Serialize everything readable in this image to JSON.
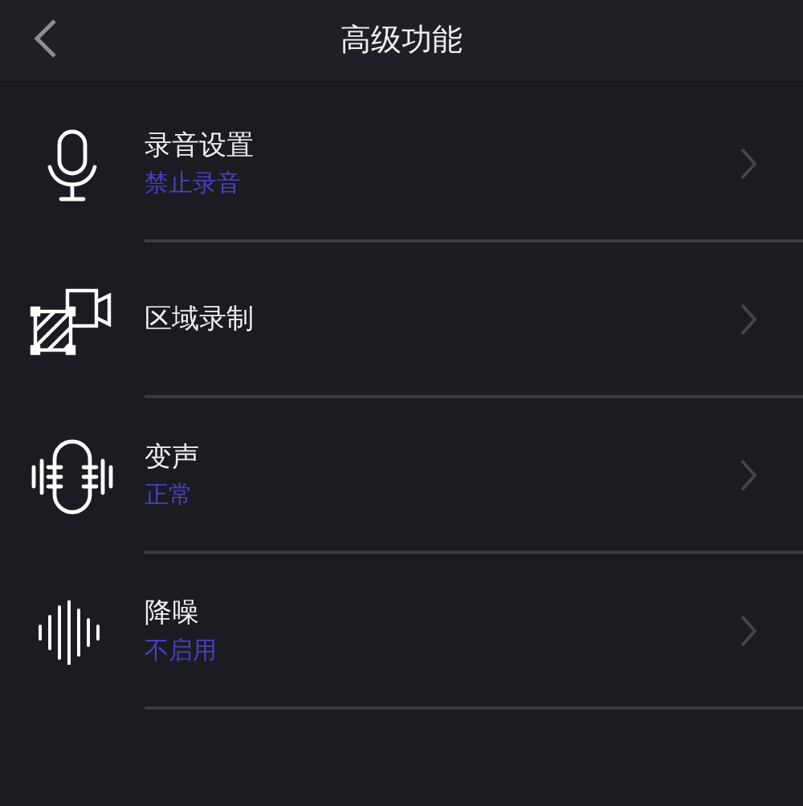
{
  "header": {
    "title": "高级功能"
  },
  "items": [
    {
      "kind": "microphone",
      "label": "录音设置",
      "value": "禁止录音"
    },
    {
      "kind": "region",
      "label": "区域录制"
    },
    {
      "kind": "voice",
      "label": "变声",
      "value": "正常"
    },
    {
      "kind": "noise",
      "label": "降噪",
      "value": "不启用"
    }
  ]
}
